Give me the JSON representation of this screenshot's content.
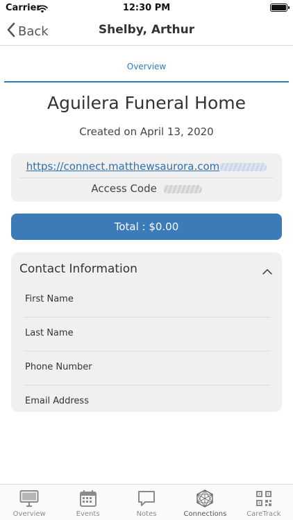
{
  "status_bar": {
    "carrier": "Carrier",
    "time": "12:30 PM"
  },
  "nav": {
    "back_label": "Back",
    "title": "Shelby, Arthur"
  },
  "tabs": {
    "overview": "Overview"
  },
  "header": {
    "title": "Aguilera Funeral Home",
    "created": "Created on April 13, 2020"
  },
  "connection": {
    "link": "https://connect.matthewsaurora.com",
    "access_code_label": "Access Code"
  },
  "total": {
    "label": "Total : $0.00"
  },
  "contact": {
    "title": "Contact Information",
    "fields": [
      "First Name",
      "Last Name",
      "Phone Number",
      "Email Address"
    ]
  },
  "tab_bar": {
    "items": [
      {
        "label": "Overview",
        "icon": "monitor-icon"
      },
      {
        "label": "Events",
        "icon": "calendar-icon"
      },
      {
        "label": "Notes",
        "icon": "speech-bubble-icon"
      },
      {
        "label": "Connections",
        "icon": "network-hexagon-icon"
      },
      {
        "label": "CareTrack",
        "icon": "qr-code-icon"
      }
    ],
    "active_index": 3
  },
  "colors": {
    "accent": "#2f7bc0",
    "total_button": "#3d7ab8",
    "card_bg": "#f0f0f0"
  }
}
